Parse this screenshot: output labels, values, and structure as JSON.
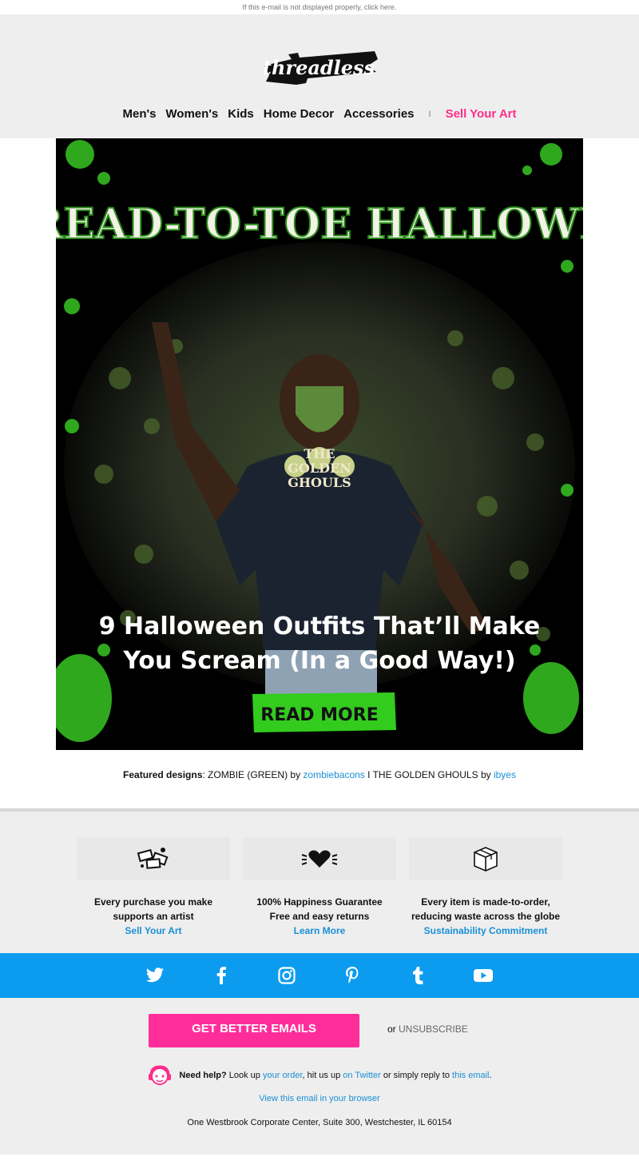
{
  "preheader": {
    "text": "If this e-mail is not displayed properly, click here."
  },
  "brand": {
    "name": "threadless",
    "accent": "#ff2d8a",
    "social_bar": "#0b9cf0"
  },
  "nav": {
    "items": [
      "Men's",
      "Women's",
      "Kids",
      "Home Decor",
      "Accessories"
    ],
    "separator": "I",
    "sell_label": "Sell Your Art"
  },
  "hero": {
    "headline": "THREAD-TO-TOE HALLOWEEN",
    "tee_text_line1": "THE",
    "tee_text_line2": "GOLDEN",
    "tee_text_line3": "GHOULS",
    "subhead_line1": "9 Halloween Outfits That’ll Make",
    "subhead_line2": "You Scream (In a Good Way!)",
    "button_label": "READ MORE"
  },
  "caption": {
    "featured_label": "Featured designs",
    "design1": ": ZOMBIE (GREEN) by ",
    "artist1": "zombiebacons",
    "mid": " I THE GOLDEN GHOULS by ",
    "artist2": "ibyes"
  },
  "values": [
    {
      "icon": "money-icon",
      "line1": "Every purchase you make",
      "line2": "supports an artist",
      "link": "Sell Your Art"
    },
    {
      "icon": "heart-icon",
      "line1": "100% Happiness Guarantee",
      "line2": "Free and easy returns",
      "link": "Learn More"
    },
    {
      "icon": "box-icon",
      "line1": "Every item is made-to-order,",
      "line2": "reducing waste across the globe",
      "link": "Sustainability Commitment"
    }
  ],
  "social": [
    "twitter-icon",
    "facebook-icon",
    "instagram-icon",
    "pinterest-icon",
    "tumblr-icon",
    "youtube-icon"
  ],
  "footer": {
    "cta_label": "GET BETTER EMAILS",
    "or": "or ",
    "unsubscribe": "UNSUBSCRIBE",
    "help_bold": "Need help?",
    "help_1": " Look up ",
    "help_link1": "your order",
    "help_2": ", hit us up ",
    "help_link2": "on Twitter",
    "help_3": " or simply reply to ",
    "help_link3": "this email",
    "help_4": ".",
    "view_browser": "View this email in your browser",
    "address": "One Westbrook Corporate Center, Suite 300, Westchester, IL 60154"
  }
}
